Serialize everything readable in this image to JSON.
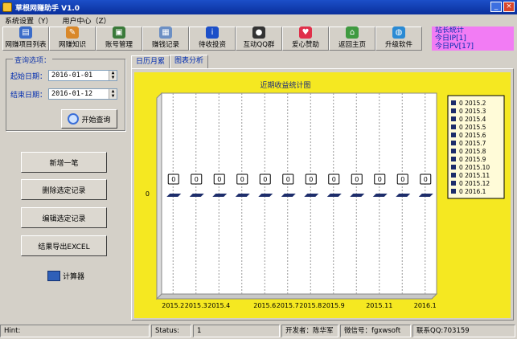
{
  "window": {
    "title": "草根网赚助手 V1.0"
  },
  "menu": [
    "系统设置（Y）",
    "用户中心（Z）"
  ],
  "toolbar": [
    {
      "label": "网赚项目列表",
      "icon": "book-icon",
      "color": "#3b6cc9"
    },
    {
      "label": "网赚知识",
      "icon": "notepad-icon",
      "color": "#d9882a"
    },
    {
      "label": "账号管理",
      "icon": "id-card-icon",
      "color": "#3a7a3a"
    },
    {
      "label": "赚钱记录",
      "icon": "document-icon",
      "color": "#6c8fc4"
    },
    {
      "label": "待收投资",
      "icon": "info-diamond-icon",
      "color": "#1c4fc8"
    },
    {
      "label": "互动QQ群",
      "icon": "qq-penguin-icon",
      "color": "#333333"
    },
    {
      "label": "爱心赞助",
      "icon": "heart-icon",
      "color": "#e0304a"
    },
    {
      "label": "返回主页",
      "icon": "house-icon",
      "color": "#3f9a40"
    },
    {
      "label": "升级软件",
      "icon": "globe-icon",
      "color": "#2a8ad4"
    }
  ],
  "stats": {
    "heading": "站长统计",
    "ip": "今日IP[1]",
    "pv": "今日PV[17]"
  },
  "query": {
    "legend": "查询选项：",
    "start_label": "起始日期：",
    "start_value": "2016-01-01",
    "end_label": "结束日期：",
    "end_value": "2016-01-12",
    "button": "开始查询"
  },
  "actions": {
    "add": "新增一笔",
    "delete": "删除选定记录",
    "edit": "编辑选定记录",
    "export": "结果导出EXCEL",
    "calculator": "计算器"
  },
  "tabs": [
    "日历月累",
    "图表分析"
  ],
  "chart_data": {
    "type": "bar",
    "title": "近期收益统计图",
    "series": [
      {
        "name": "2015.2",
        "values": [
          0
        ]
      },
      {
        "name": "2015.3",
        "values": [
          0
        ]
      },
      {
        "name": "2015.4",
        "values": [
          0
        ]
      },
      {
        "name": "2015.5",
        "values": [
          0
        ]
      },
      {
        "name": "2015.6",
        "values": [
          0
        ]
      },
      {
        "name": "2015.7",
        "values": [
          0
        ]
      },
      {
        "name": "2015.8",
        "values": [
          0
        ]
      },
      {
        "name": "2015.9",
        "values": [
          0
        ]
      },
      {
        "name": "2015.10",
        "values": [
          0
        ]
      },
      {
        "name": "2015.11",
        "values": [
          0
        ]
      },
      {
        "name": "2015.12",
        "values": [
          0
        ]
      },
      {
        "name": "2016.1",
        "values": [
          0
        ]
      }
    ],
    "legend_value_prefix": "0",
    "y_tick": "0",
    "x_tick_labels": [
      "2015.2",
      "2015.3",
      "2015.4",
      "",
      "2015.6",
      "2015.7",
      "2015.8",
      "2015.9",
      "",
      "2015.11",
      "",
      "2016.1"
    ],
    "legend_position": "right",
    "colors": {
      "background": "#f5e821",
      "plot": "#ffffff",
      "bar": "#1d2d6b",
      "legend_bg": "#fffbd8"
    }
  },
  "status": {
    "hint_label": "Hint:",
    "status_label": "Status:",
    "status_value": "1",
    "developer": "开发者：陈华军",
    "wechat": "微信号：fgxwsoft",
    "qq": "联系QQ:703159"
  }
}
